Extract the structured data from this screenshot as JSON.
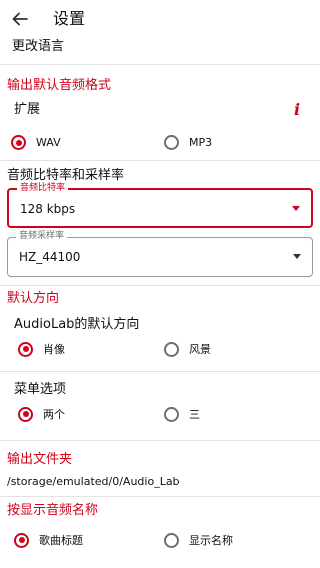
{
  "appbar": {
    "title": "设置",
    "back_icon": "arrow-left-icon"
  },
  "language": {
    "label": "更改语言"
  },
  "output_format": {
    "header": "输出默认音频格式",
    "extension_label": "扩展",
    "info_icon": "i",
    "options": [
      {
        "label": "WAV",
        "selected": true
      },
      {
        "label": "MP3",
        "selected": false
      }
    ]
  },
  "bitrate_section": {
    "title": "音频比特率和采样率",
    "bitrate": {
      "label": "音频比特率",
      "value": "128 kbps"
    },
    "samplerate": {
      "label": "音频采样率",
      "value": "HZ_44100"
    }
  },
  "orientation": {
    "header": "默认方向",
    "title": "AudioLab的默认方向",
    "options": [
      {
        "label": "肖像",
        "selected": true
      },
      {
        "label": "风景",
        "selected": false
      }
    ]
  },
  "menu_options": {
    "title": "菜单选项",
    "options": [
      {
        "label": "两个",
        "selected": true
      },
      {
        "label": "三",
        "selected": false
      }
    ]
  },
  "output_folder": {
    "header": "输出文件夹",
    "path": "/storage/emulated/0/Audio_Lab"
  },
  "display_name": {
    "header": "按显示音频名称",
    "options": [
      {
        "label": "歌曲标题",
        "selected": true
      },
      {
        "label": "显示名称",
        "selected": false
      }
    ]
  },
  "colors": {
    "accent": "#d0021b",
    "divider": "#e2e2e2"
  }
}
